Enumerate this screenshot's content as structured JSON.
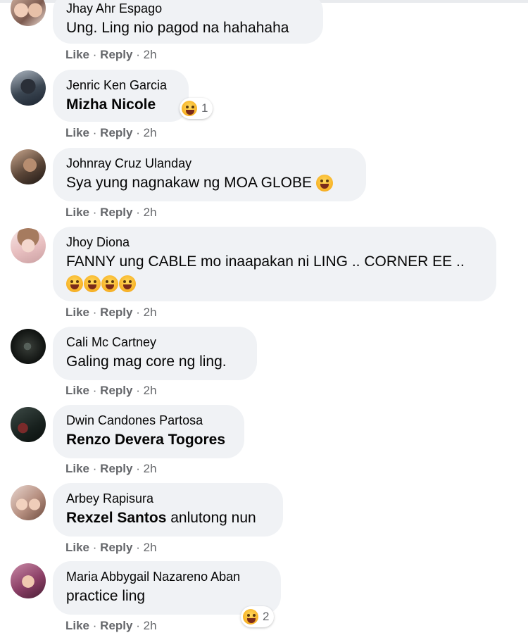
{
  "comments": [
    {
      "author": "Jhay Ahr Espago",
      "text": "Ung. Ling nio pagod na hahahaha",
      "actions": {
        "like": "Like",
        "sep": "·",
        "reply": "Reply",
        "time": "2h"
      }
    },
    {
      "author": "Jenric Ken Garcia",
      "mention": "Mizha Nicole",
      "reaction": {
        "icon": "haha-icon",
        "count": "1"
      },
      "actions": {
        "like": "Like",
        "sep": "·",
        "reply": "Reply",
        "time": "2h"
      }
    },
    {
      "author": "Johnray Cruz Ulanday",
      "text": "Sya yung nagnakaw ng MOA GLOBE",
      "emoji": "grinning-sweat-icon",
      "actions": {
        "like": "Like",
        "sep": "·",
        "reply": "Reply",
        "time": "2h"
      }
    },
    {
      "author": "Jhoy Diona",
      "text": "FANNY ung CABLE mo inaapakan ni LING .. CORNER EE ..",
      "emoji_count": 4,
      "emoji": "rolling-laughing-icon",
      "actions": {
        "like": "Like",
        "sep": "·",
        "reply": "Reply",
        "time": "2h"
      }
    },
    {
      "author": "Cali Mc Cartney",
      "text": "Galing mag core ng ling.",
      "actions": {
        "like": "Like",
        "sep": "·",
        "reply": "Reply",
        "time": "2h"
      }
    },
    {
      "author": "Dwin Candones Partosa",
      "mention": "Renzo Devera Togores",
      "actions": {
        "like": "Like",
        "sep": "·",
        "reply": "Reply",
        "time": "2h"
      }
    },
    {
      "author": "Arbey Rapisura",
      "mention": "Rexzel Santos",
      "text": " anlutong nun",
      "actions": {
        "like": "Like",
        "sep": "·",
        "reply": "Reply",
        "time": "2h"
      }
    },
    {
      "author": "Maria Abbygail Nazareno Aban",
      "text": "practice ling",
      "reaction": {
        "icon": "haha-icon",
        "count": "2"
      },
      "actions": {
        "like": "Like",
        "sep": "·",
        "reply": "Reply",
        "time": "2h"
      }
    }
  ],
  "colors": {
    "bubble": "#f0f2f5",
    "meta": "#65676b",
    "text": "#050505"
  }
}
